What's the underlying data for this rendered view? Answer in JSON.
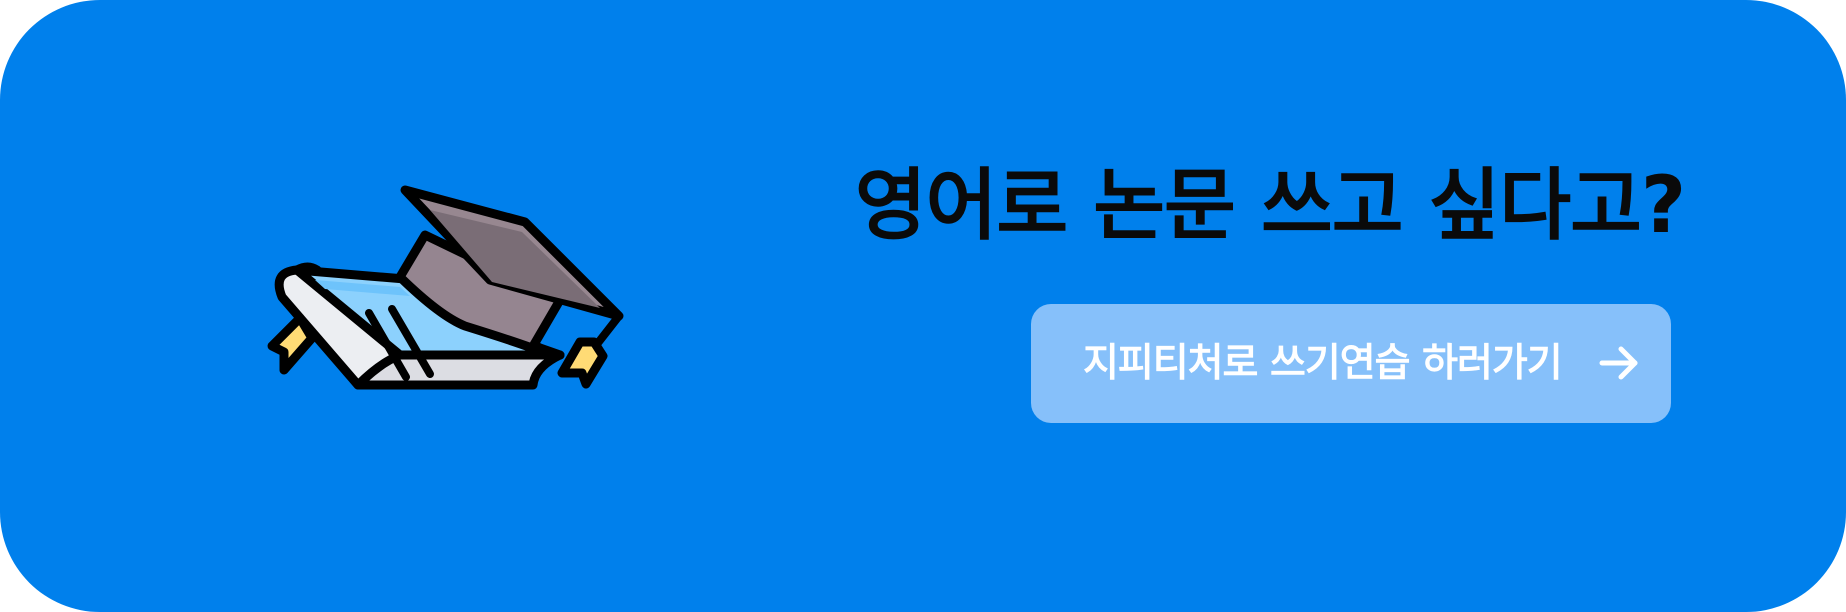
{
  "banner": {
    "headline": "영어로 논문 쓰고 싶다고?",
    "cta": {
      "label": "지피티처로 쓰기연습 하러가기",
      "icon": "arrow-right-icon"
    },
    "illustration": {
      "icon": "graduation-cap-book-icon"
    },
    "colors": {
      "background": "#0080ec",
      "button": "#86c0fa",
      "button_text": "#ffffff",
      "headline_text": "#0a0a0a"
    }
  }
}
